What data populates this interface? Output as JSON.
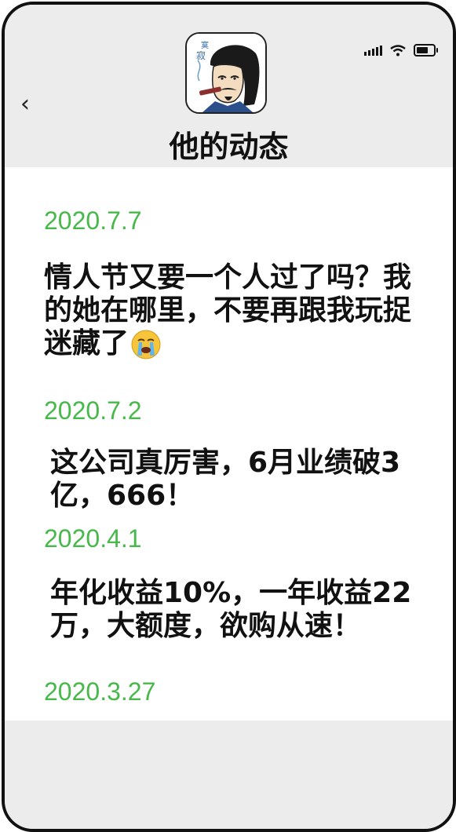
{
  "header": {
    "title": "他的动态"
  },
  "posts": [
    {
      "date": "2020.7.7",
      "text": "情人节又要一个人过了吗？我的她在哪里，不要再跟我玩捉迷藏了"
    },
    {
      "date": "2020.7.2",
      "text": "这公司真厉害，6月业绩破3亿，666！"
    },
    {
      "date": "2020.4.1",
      "text": "年化收益10%，一年收益22万，大额度，欲购从速！"
    },
    {
      "date": "2020.3.27",
      "text": ""
    }
  ],
  "icons": {
    "back": "chevron-left-icon",
    "signal": "signal-icon",
    "wifi": "wifi-icon",
    "battery": "battery-icon",
    "crying": "crying-face-icon"
  },
  "colors": {
    "date_green": "#47b84a",
    "header_bg": "#ececec"
  }
}
